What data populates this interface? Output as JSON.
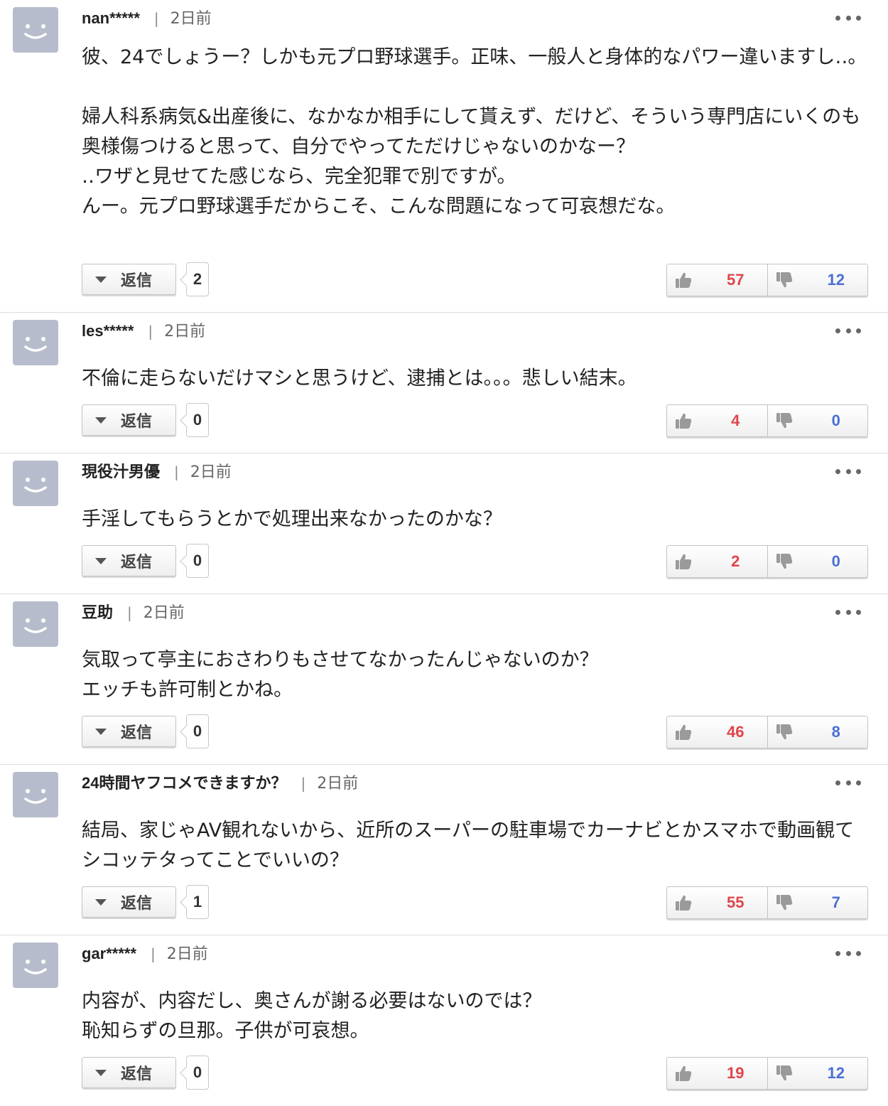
{
  "icons": {
    "avatar": "smiley-avatar-icon",
    "menu": "ellipsis-icon",
    "reply_toggle": "triangle-down-icon",
    "like": "thumbs-up-icon",
    "dislike": "thumbs-down-icon"
  },
  "colors": {
    "like": "#e0454b",
    "dislike": "#4a6fd6",
    "avatar_bg": "#b6bccb"
  },
  "reply_label": "返信",
  "comments": [
    {
      "username": "nan*****",
      "time": "2日前",
      "text": "彼、24でしょうー？しかも元プロ野球選手。正味、一般人と身体的なパワー違いますし‥。\n\n婦人科系病気&出産後に、なかなか相手にして貰えず、だけど、そういう専門店にいくのも奥様傷つけると思って、自分でやってただけじゃないのかなー？\n‥ワザと見せてた感じなら、完全犯罪で別ですが。\nんー。元プロ野球選手だからこそ、こんな問題になって可哀想だな。",
      "reply_count": "2",
      "likes": "57",
      "dislikes": "12"
    },
    {
      "username": "les*****",
      "time": "2日前",
      "text": "不倫に走らないだけマシと思うけど、逮捕とは。。。悲しい結末。",
      "reply_count": "0",
      "likes": "4",
      "dislikes": "0"
    },
    {
      "username": "現役汁男優",
      "time": "2日前",
      "text": "手淫してもらうとかで処理出来なかったのかな？",
      "reply_count": "0",
      "likes": "2",
      "dislikes": "0"
    },
    {
      "username": "豆助",
      "time": "2日前",
      "text": "気取って亭主におさわりもさせてなかったんじゃないのか？\nエッチも許可制とかね。",
      "reply_count": "0",
      "likes": "46",
      "dislikes": "8"
    },
    {
      "username": "24時間ヤフコメできますか？",
      "time": "2日前",
      "text": "結局、家じゃAV観れないから、近所のスーパーの駐車場でカーナビとかスマホで動画観てシコッテタってことでいいの？",
      "reply_count": "1",
      "likes": "55",
      "dislikes": "7"
    },
    {
      "username": "gar*****",
      "time": "2日前",
      "text": "内容が、内容だし、奥さんが謝る必要はないのでは？\n恥知らずの旦那。子供が可哀想。",
      "reply_count": "0",
      "likes": "19",
      "dislikes": "12"
    }
  ]
}
